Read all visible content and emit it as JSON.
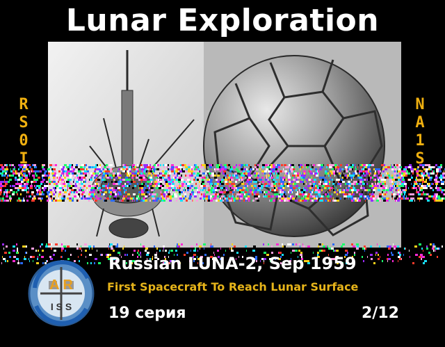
{
  "title": "Lunar Exploration",
  "callsign_left": [
    "R",
    "S",
    "0",
    "I",
    "S"
  ],
  "callsign_right": [
    "N",
    "A",
    "1",
    "S",
    "S"
  ],
  "caption": {
    "spacecraft": "Russian LUNA-2, Sep 1959",
    "subtitle": "First Spacecraft To Reach Lunar Surface",
    "series": "19 серия",
    "image_count": "2/12"
  },
  "logo": {
    "letters_top": "A R",
    "letters_bottom": "I S S"
  },
  "colors": {
    "background": "#000000",
    "title": "#ffffff",
    "callsign": "#f0b010",
    "subtitle": "#e6b41a"
  },
  "icons": [
    "ariss-logo-icon"
  ]
}
